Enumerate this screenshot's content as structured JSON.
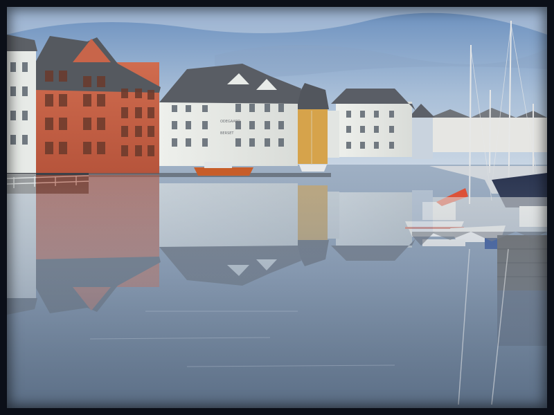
{
  "scene": {
    "subject": "harbour-canal-with-art-nouveau-buildings",
    "building_signs": [
      "ODEGAARD",
      "BERSET"
    ]
  },
  "palette": {
    "sky_top": "#5f86b8",
    "sky_bottom": "#b9cbe0",
    "water_top": "#a9b6c6",
    "water_bottom": "#5c6f86",
    "brick": "#c8654a",
    "white_building": "#e9ece9",
    "yellow_building": "#d5a24a",
    "roof": "#5b5f66",
    "frame": "#0b0f18"
  }
}
